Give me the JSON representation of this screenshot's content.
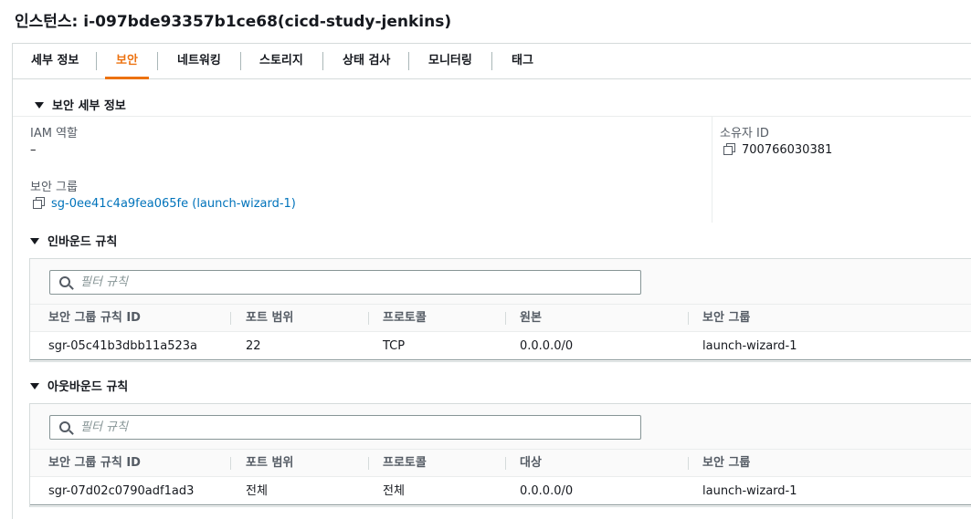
{
  "page": {
    "title": "인스턴스: i-097bde93357b1ce68(cicd-study-jenkins)"
  },
  "tabs": [
    {
      "label": "세부 정보",
      "active": false
    },
    {
      "label": "보안",
      "active": true
    },
    {
      "label": "네트워킹",
      "active": false
    },
    {
      "label": "스토리지",
      "active": false
    },
    {
      "label": "상태 검사",
      "active": false
    },
    {
      "label": "모니터링",
      "active": false
    },
    {
      "label": "태그",
      "active": false
    }
  ],
  "security_details": {
    "header": "보안 세부 정보",
    "iam_role_label": "IAM 역할",
    "iam_role_value": "–",
    "owner_id_label": "소유자 ID",
    "owner_id_value": "700766030381",
    "security_groups_label": "보안 그룹",
    "security_groups_value": "sg-0ee41c4a9fea065fe (launch-wizard-1)"
  },
  "inbound": {
    "header": "인바운드 규칙",
    "search_placeholder": "필터 규칙",
    "columns": [
      "보안 그룹 규칙 ID",
      "포트 범위",
      "프로토콜",
      "원본",
      "보안 그룹"
    ],
    "rows": [
      [
        "sgr-05c41b3dbb11a523a",
        "22",
        "TCP",
        "0.0.0.0/0",
        "launch-wizard-1"
      ]
    ]
  },
  "outbound": {
    "header": "아웃바운드 규칙",
    "search_placeholder": "필터 규칙",
    "columns": [
      "보안 그룹 규칙 ID",
      "포트 범위",
      "프로토콜",
      "대상",
      "보안 그룹"
    ],
    "rows": [
      [
        "sgr-07d02c0790adf1ad3",
        "전체",
        "전체",
        "0.0.0.0/0",
        "launch-wizard-1"
      ]
    ]
  },
  "colors": {
    "accent": "#ec7211",
    "link": "#0073bb",
    "text": "#16191f",
    "muted": "#545b64",
    "border": "#d5dbdb"
  }
}
